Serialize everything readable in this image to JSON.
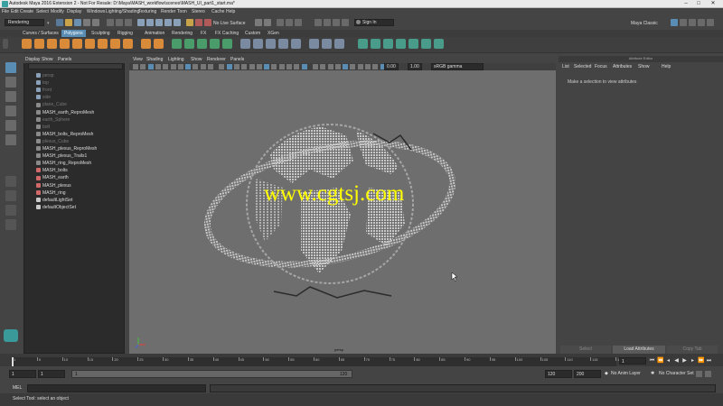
{
  "window": {
    "title": "Autodesk Maya 2016 Extension 2 - Not For Resale: D:\\Maya\\MASH_workflow\\scenes\\MASH_UI_part1_start.ma*"
  },
  "menus": [
    "File",
    "Edit",
    "Create",
    "Select",
    "Modify",
    "Display",
    "Windows",
    "Lighting/Shading",
    "Texturing",
    "Render",
    "Toon",
    "Stereo",
    "Cache",
    "Help"
  ],
  "status": {
    "mode": "Rendering",
    "live_surface": "No Live Surface",
    "sign_in": "Sign In",
    "workspace": "Maya Classic"
  },
  "shelf_tabs": [
    "Curves / Surfaces",
    "Polygons",
    "Sculpting",
    "Rigging",
    "Animation",
    "Rendering",
    "FX",
    "FX Caching",
    "Custom",
    "XGen"
  ],
  "shelf_active": 1,
  "outliner": {
    "menu": [
      "Display",
      "Show",
      "Panels"
    ],
    "items": [
      {
        "label": "persp",
        "dim": true,
        "icon": "camera"
      },
      {
        "label": "top",
        "dim": true,
        "icon": "camera"
      },
      {
        "label": "front",
        "dim": true,
        "icon": "camera"
      },
      {
        "label": "side",
        "dim": true,
        "icon": "camera"
      },
      {
        "label": "plane_Cube",
        "dim": true,
        "icon": "mesh"
      },
      {
        "label": "MASH_earth_ReproMesh",
        "dim": false,
        "icon": "mesh"
      },
      {
        "label": "earth_Sphere",
        "dim": true,
        "icon": "mesh"
      },
      {
        "label": "bolt",
        "dim": true,
        "icon": "mesh"
      },
      {
        "label": "MASH_bolts_ReproMesh",
        "dim": false,
        "icon": "mesh"
      },
      {
        "label": "plexus_Cube",
        "dim": true,
        "icon": "mesh"
      },
      {
        "label": "MASH_plexus_ReproMesh",
        "dim": false,
        "icon": "mesh"
      },
      {
        "label": "MASH_plexus_Trails1",
        "dim": false,
        "icon": "mesh"
      },
      {
        "label": "MASH_ring_ReproMesh",
        "dim": false,
        "icon": "mesh"
      },
      {
        "label": "MASH_bolts",
        "dim": false,
        "icon": "mash"
      },
      {
        "label": "MASH_earth",
        "dim": false,
        "icon": "mash"
      },
      {
        "label": "MASH_plexus",
        "dim": false,
        "icon": "mash"
      },
      {
        "label": "MASH_ring",
        "dim": false,
        "icon": "mash"
      },
      {
        "label": "defaultLightSet",
        "dim": false,
        "icon": "set"
      },
      {
        "label": "defaultObjectSet",
        "dim": false,
        "icon": "set"
      }
    ]
  },
  "viewport": {
    "menu": [
      "View",
      "Shading",
      "Lighting",
      "Show",
      "Renderer",
      "Panels"
    ],
    "gamma": "sRGB gamma",
    "val1": "0.00",
    "val2": "1.00",
    "camera_label": "persp"
  },
  "attribute_editor": {
    "title": "Attribute Editor",
    "menu": [
      "List",
      "Selected",
      "Focus",
      "Attributes",
      "Show",
      "Help"
    ],
    "message": "Make a selection to view attributes",
    "buttons": [
      "Select",
      "Load Attributes",
      "Copy Tab"
    ]
  },
  "timeline": {
    "ticks": [
      "1",
      "5",
      "10",
      "15",
      "20",
      "25",
      "30",
      "35",
      "40",
      "45",
      "50",
      "55",
      "60",
      "65",
      "70",
      "75",
      "80",
      "85",
      "90",
      "95",
      "100",
      "105",
      "110",
      "115",
      "120"
    ],
    "current_frame": "1"
  },
  "range": {
    "start": "1",
    "anim_start": "1",
    "range_start": "1",
    "range_end": "120",
    "end": "120",
    "anim_end": "200",
    "anim_layer": "No Anim Layer",
    "char_set": "No Character Set"
  },
  "command_line": {
    "label": "MEL"
  },
  "help_line": "Select Tool: select an object",
  "watermark": "www.cgtsj.com",
  "colors": {
    "accent": "#5a8db3",
    "viewport": "#6e6e6e"
  }
}
